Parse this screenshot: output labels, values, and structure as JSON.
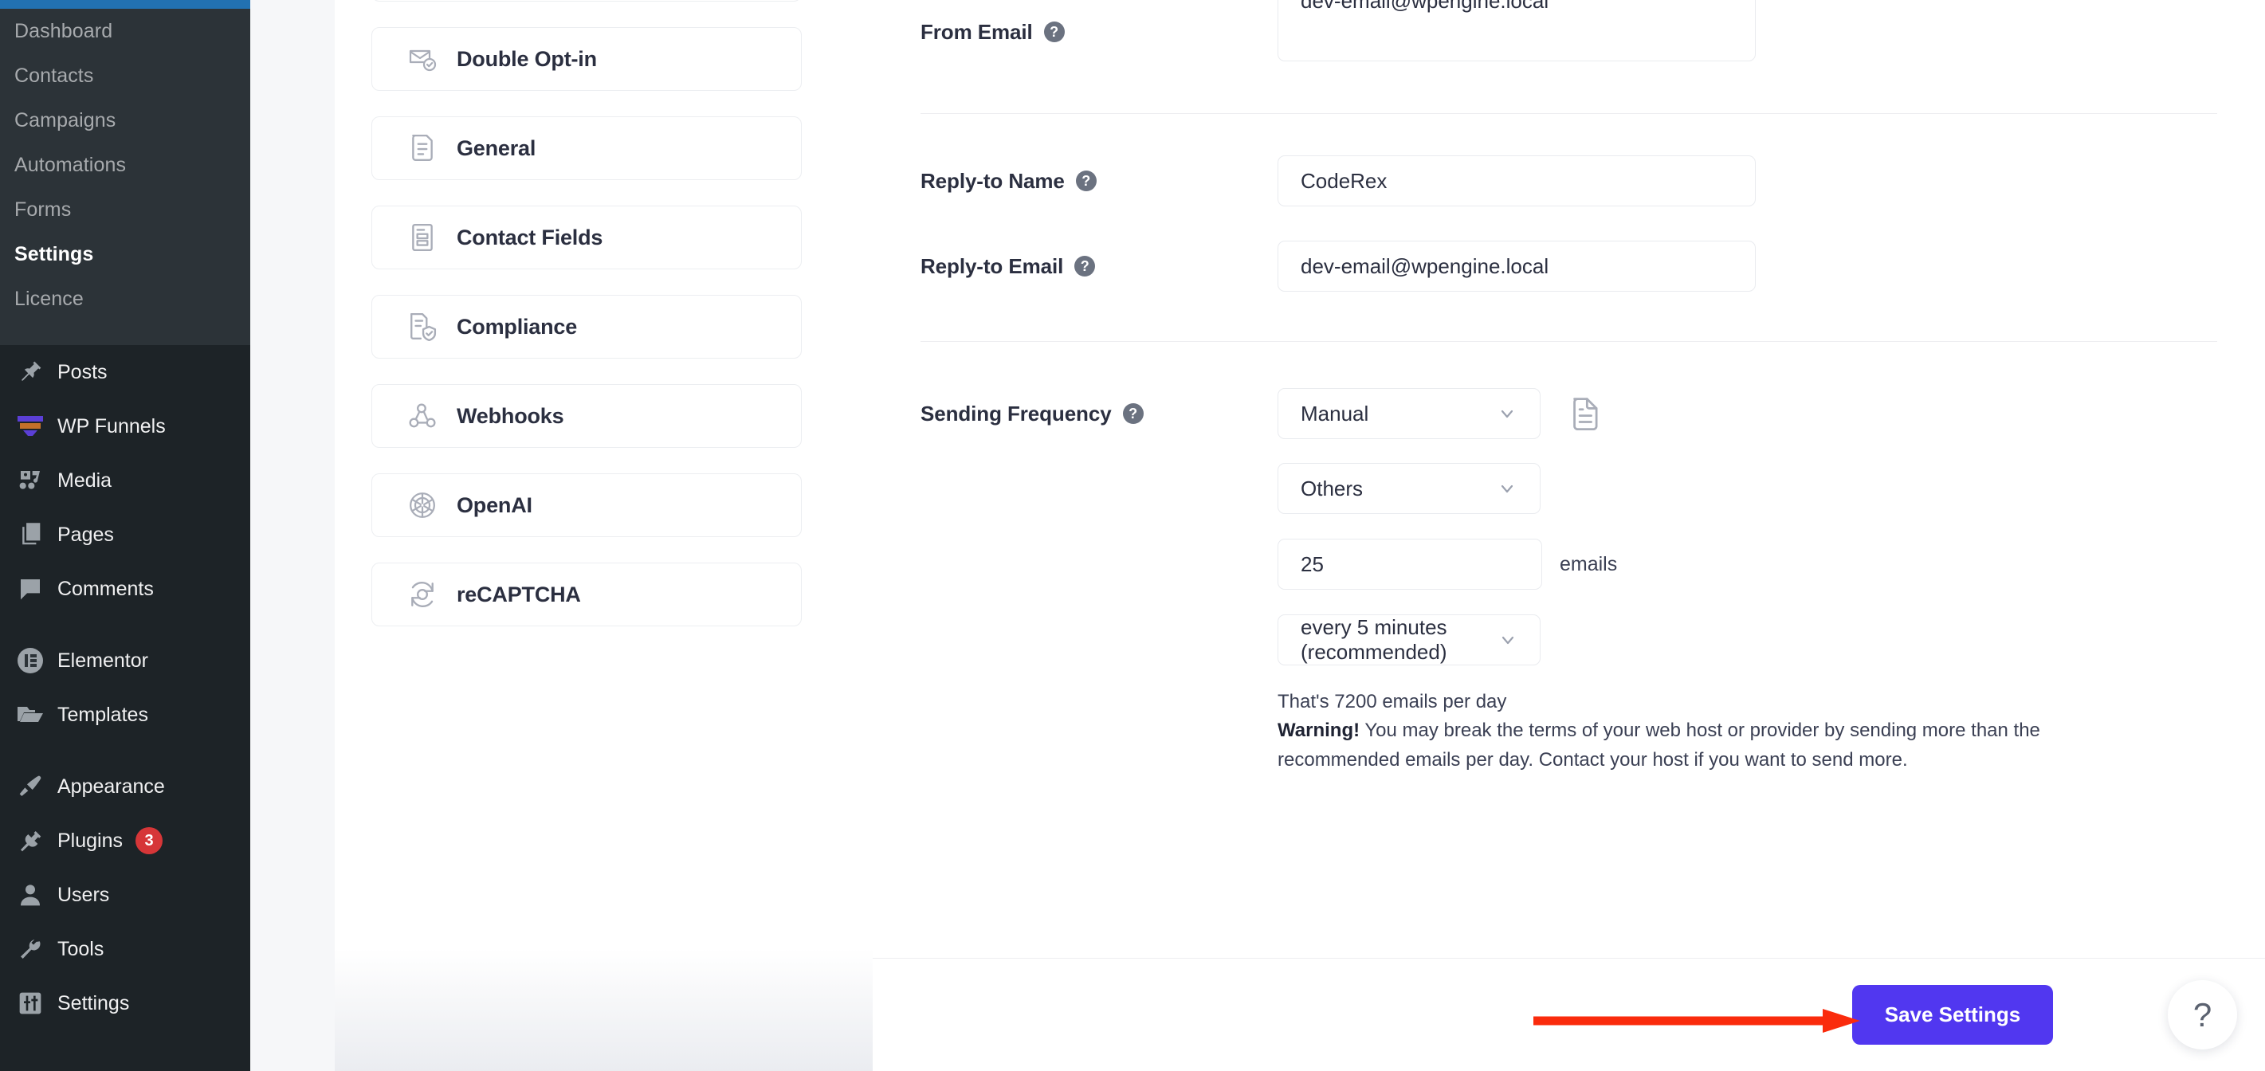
{
  "wp_admin": {
    "plugin_submenu": [
      {
        "label": "Dashboard",
        "current": false
      },
      {
        "label": "Contacts",
        "current": false
      },
      {
        "label": "Campaigns",
        "current": false
      },
      {
        "label": "Automations",
        "current": false
      },
      {
        "label": "Forms",
        "current": false
      },
      {
        "label": "Settings",
        "current": true
      },
      {
        "label": "Licence",
        "current": false
      }
    ],
    "menu": [
      {
        "label": "Posts",
        "icon": "pin-icon",
        "badge": ""
      },
      {
        "label": "WP Funnels",
        "icon": "funnel-icon",
        "badge": ""
      },
      {
        "label": "Media",
        "icon": "media-icon",
        "badge": ""
      },
      {
        "label": "Pages",
        "icon": "pages-icon",
        "badge": ""
      },
      {
        "label": "Comments",
        "icon": "comment-icon",
        "badge": ""
      },
      {
        "label": "Elementor",
        "icon": "elementor-icon",
        "badge": ""
      },
      {
        "label": "Templates",
        "icon": "folder-icon",
        "badge": ""
      },
      {
        "label": "Appearance",
        "icon": "paintbrush-icon",
        "badge": ""
      },
      {
        "label": "Plugins",
        "icon": "plug-icon",
        "badge": "3"
      },
      {
        "label": "Users",
        "icon": "user-icon",
        "badge": ""
      },
      {
        "label": "Tools",
        "icon": "wrench-icon",
        "badge": ""
      },
      {
        "label": "Settings",
        "icon": "sliders-icon",
        "badge": ""
      }
    ]
  },
  "settings_nav": {
    "cards": [
      {
        "label": "",
        "icon": "partial-card"
      },
      {
        "label": "Double Opt-in",
        "icon": "mail-check-icon"
      },
      {
        "label": "General",
        "icon": "document-icon"
      },
      {
        "label": "Contact Fields",
        "icon": "form-fields-icon"
      },
      {
        "label": "Compliance",
        "icon": "document-shield-icon"
      },
      {
        "label": "Webhooks",
        "icon": "webhook-icon"
      },
      {
        "label": "OpenAI",
        "icon": "openai-icon"
      },
      {
        "label": "reCAPTCHA",
        "icon": "recaptcha-icon"
      }
    ]
  },
  "form": {
    "from_email": {
      "label": "From Email",
      "help": "?",
      "value": "dev-email@wpengine.local"
    },
    "reply_to_name": {
      "label": "Reply-to Name",
      "help": "?",
      "value": "CodeRex"
    },
    "reply_to_email": {
      "label": "Reply-to Email",
      "help": "?",
      "value": "dev-email@wpengine.local"
    },
    "sending_frequency": {
      "label": "Sending Frequency",
      "help": "?",
      "mode": "Manual",
      "provider": "Others",
      "amount": "25",
      "amount_unit": "emails",
      "interval": "every 5 minutes (recommended)",
      "summary": "That's 7200 emails per day",
      "warning_strong": "Warning!",
      "warning_text": " You may break the terms of your web host or provider by sending more than the recommended emails per day. Contact your host if you want to send more."
    }
  },
  "footer": {
    "save_label": "Save Settings",
    "help_glyph": "?"
  },
  "colors": {
    "accent": "#5137f0",
    "admin_bar": "#2271b1",
    "sidebar": "#1d2327",
    "submenu": "#2c3338",
    "badge": "#d63638",
    "annotation": "#fa2b0c"
  }
}
